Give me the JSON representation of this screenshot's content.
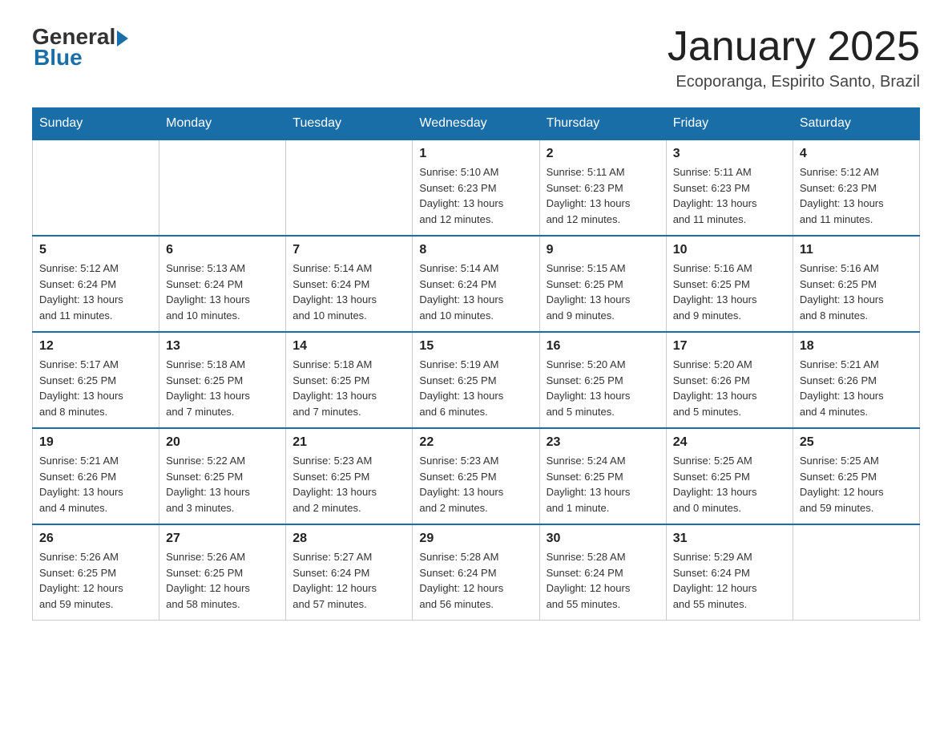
{
  "header": {
    "logo_general": "General",
    "logo_blue": "Blue",
    "month_title": "January 2025",
    "location": "Ecoporanga, Espirito Santo, Brazil"
  },
  "days_of_week": [
    "Sunday",
    "Monday",
    "Tuesday",
    "Wednesday",
    "Thursday",
    "Friday",
    "Saturday"
  ],
  "weeks": [
    [
      {
        "day": "",
        "info": ""
      },
      {
        "day": "",
        "info": ""
      },
      {
        "day": "",
        "info": ""
      },
      {
        "day": "1",
        "info": "Sunrise: 5:10 AM\nSunset: 6:23 PM\nDaylight: 13 hours\nand 12 minutes."
      },
      {
        "day": "2",
        "info": "Sunrise: 5:11 AM\nSunset: 6:23 PM\nDaylight: 13 hours\nand 12 minutes."
      },
      {
        "day": "3",
        "info": "Sunrise: 5:11 AM\nSunset: 6:23 PM\nDaylight: 13 hours\nand 11 minutes."
      },
      {
        "day": "4",
        "info": "Sunrise: 5:12 AM\nSunset: 6:23 PM\nDaylight: 13 hours\nand 11 minutes."
      }
    ],
    [
      {
        "day": "5",
        "info": "Sunrise: 5:12 AM\nSunset: 6:24 PM\nDaylight: 13 hours\nand 11 minutes."
      },
      {
        "day": "6",
        "info": "Sunrise: 5:13 AM\nSunset: 6:24 PM\nDaylight: 13 hours\nand 10 minutes."
      },
      {
        "day": "7",
        "info": "Sunrise: 5:14 AM\nSunset: 6:24 PM\nDaylight: 13 hours\nand 10 minutes."
      },
      {
        "day": "8",
        "info": "Sunrise: 5:14 AM\nSunset: 6:24 PM\nDaylight: 13 hours\nand 10 minutes."
      },
      {
        "day": "9",
        "info": "Sunrise: 5:15 AM\nSunset: 6:25 PM\nDaylight: 13 hours\nand 9 minutes."
      },
      {
        "day": "10",
        "info": "Sunrise: 5:16 AM\nSunset: 6:25 PM\nDaylight: 13 hours\nand 9 minutes."
      },
      {
        "day": "11",
        "info": "Sunrise: 5:16 AM\nSunset: 6:25 PM\nDaylight: 13 hours\nand 8 minutes."
      }
    ],
    [
      {
        "day": "12",
        "info": "Sunrise: 5:17 AM\nSunset: 6:25 PM\nDaylight: 13 hours\nand 8 minutes."
      },
      {
        "day": "13",
        "info": "Sunrise: 5:18 AM\nSunset: 6:25 PM\nDaylight: 13 hours\nand 7 minutes."
      },
      {
        "day": "14",
        "info": "Sunrise: 5:18 AM\nSunset: 6:25 PM\nDaylight: 13 hours\nand 7 minutes."
      },
      {
        "day": "15",
        "info": "Sunrise: 5:19 AM\nSunset: 6:25 PM\nDaylight: 13 hours\nand 6 minutes."
      },
      {
        "day": "16",
        "info": "Sunrise: 5:20 AM\nSunset: 6:25 PM\nDaylight: 13 hours\nand 5 minutes."
      },
      {
        "day": "17",
        "info": "Sunrise: 5:20 AM\nSunset: 6:26 PM\nDaylight: 13 hours\nand 5 minutes."
      },
      {
        "day": "18",
        "info": "Sunrise: 5:21 AM\nSunset: 6:26 PM\nDaylight: 13 hours\nand 4 minutes."
      }
    ],
    [
      {
        "day": "19",
        "info": "Sunrise: 5:21 AM\nSunset: 6:26 PM\nDaylight: 13 hours\nand 4 minutes."
      },
      {
        "day": "20",
        "info": "Sunrise: 5:22 AM\nSunset: 6:25 PM\nDaylight: 13 hours\nand 3 minutes."
      },
      {
        "day": "21",
        "info": "Sunrise: 5:23 AM\nSunset: 6:25 PM\nDaylight: 13 hours\nand 2 minutes."
      },
      {
        "day": "22",
        "info": "Sunrise: 5:23 AM\nSunset: 6:25 PM\nDaylight: 13 hours\nand 2 minutes."
      },
      {
        "day": "23",
        "info": "Sunrise: 5:24 AM\nSunset: 6:25 PM\nDaylight: 13 hours\nand 1 minute."
      },
      {
        "day": "24",
        "info": "Sunrise: 5:25 AM\nSunset: 6:25 PM\nDaylight: 13 hours\nand 0 minutes."
      },
      {
        "day": "25",
        "info": "Sunrise: 5:25 AM\nSunset: 6:25 PM\nDaylight: 12 hours\nand 59 minutes."
      }
    ],
    [
      {
        "day": "26",
        "info": "Sunrise: 5:26 AM\nSunset: 6:25 PM\nDaylight: 12 hours\nand 59 minutes."
      },
      {
        "day": "27",
        "info": "Sunrise: 5:26 AM\nSunset: 6:25 PM\nDaylight: 12 hours\nand 58 minutes."
      },
      {
        "day": "28",
        "info": "Sunrise: 5:27 AM\nSunset: 6:24 PM\nDaylight: 12 hours\nand 57 minutes."
      },
      {
        "day": "29",
        "info": "Sunrise: 5:28 AM\nSunset: 6:24 PM\nDaylight: 12 hours\nand 56 minutes."
      },
      {
        "day": "30",
        "info": "Sunrise: 5:28 AM\nSunset: 6:24 PM\nDaylight: 12 hours\nand 55 minutes."
      },
      {
        "day": "31",
        "info": "Sunrise: 5:29 AM\nSunset: 6:24 PM\nDaylight: 12 hours\nand 55 minutes."
      },
      {
        "day": "",
        "info": ""
      }
    ]
  ]
}
